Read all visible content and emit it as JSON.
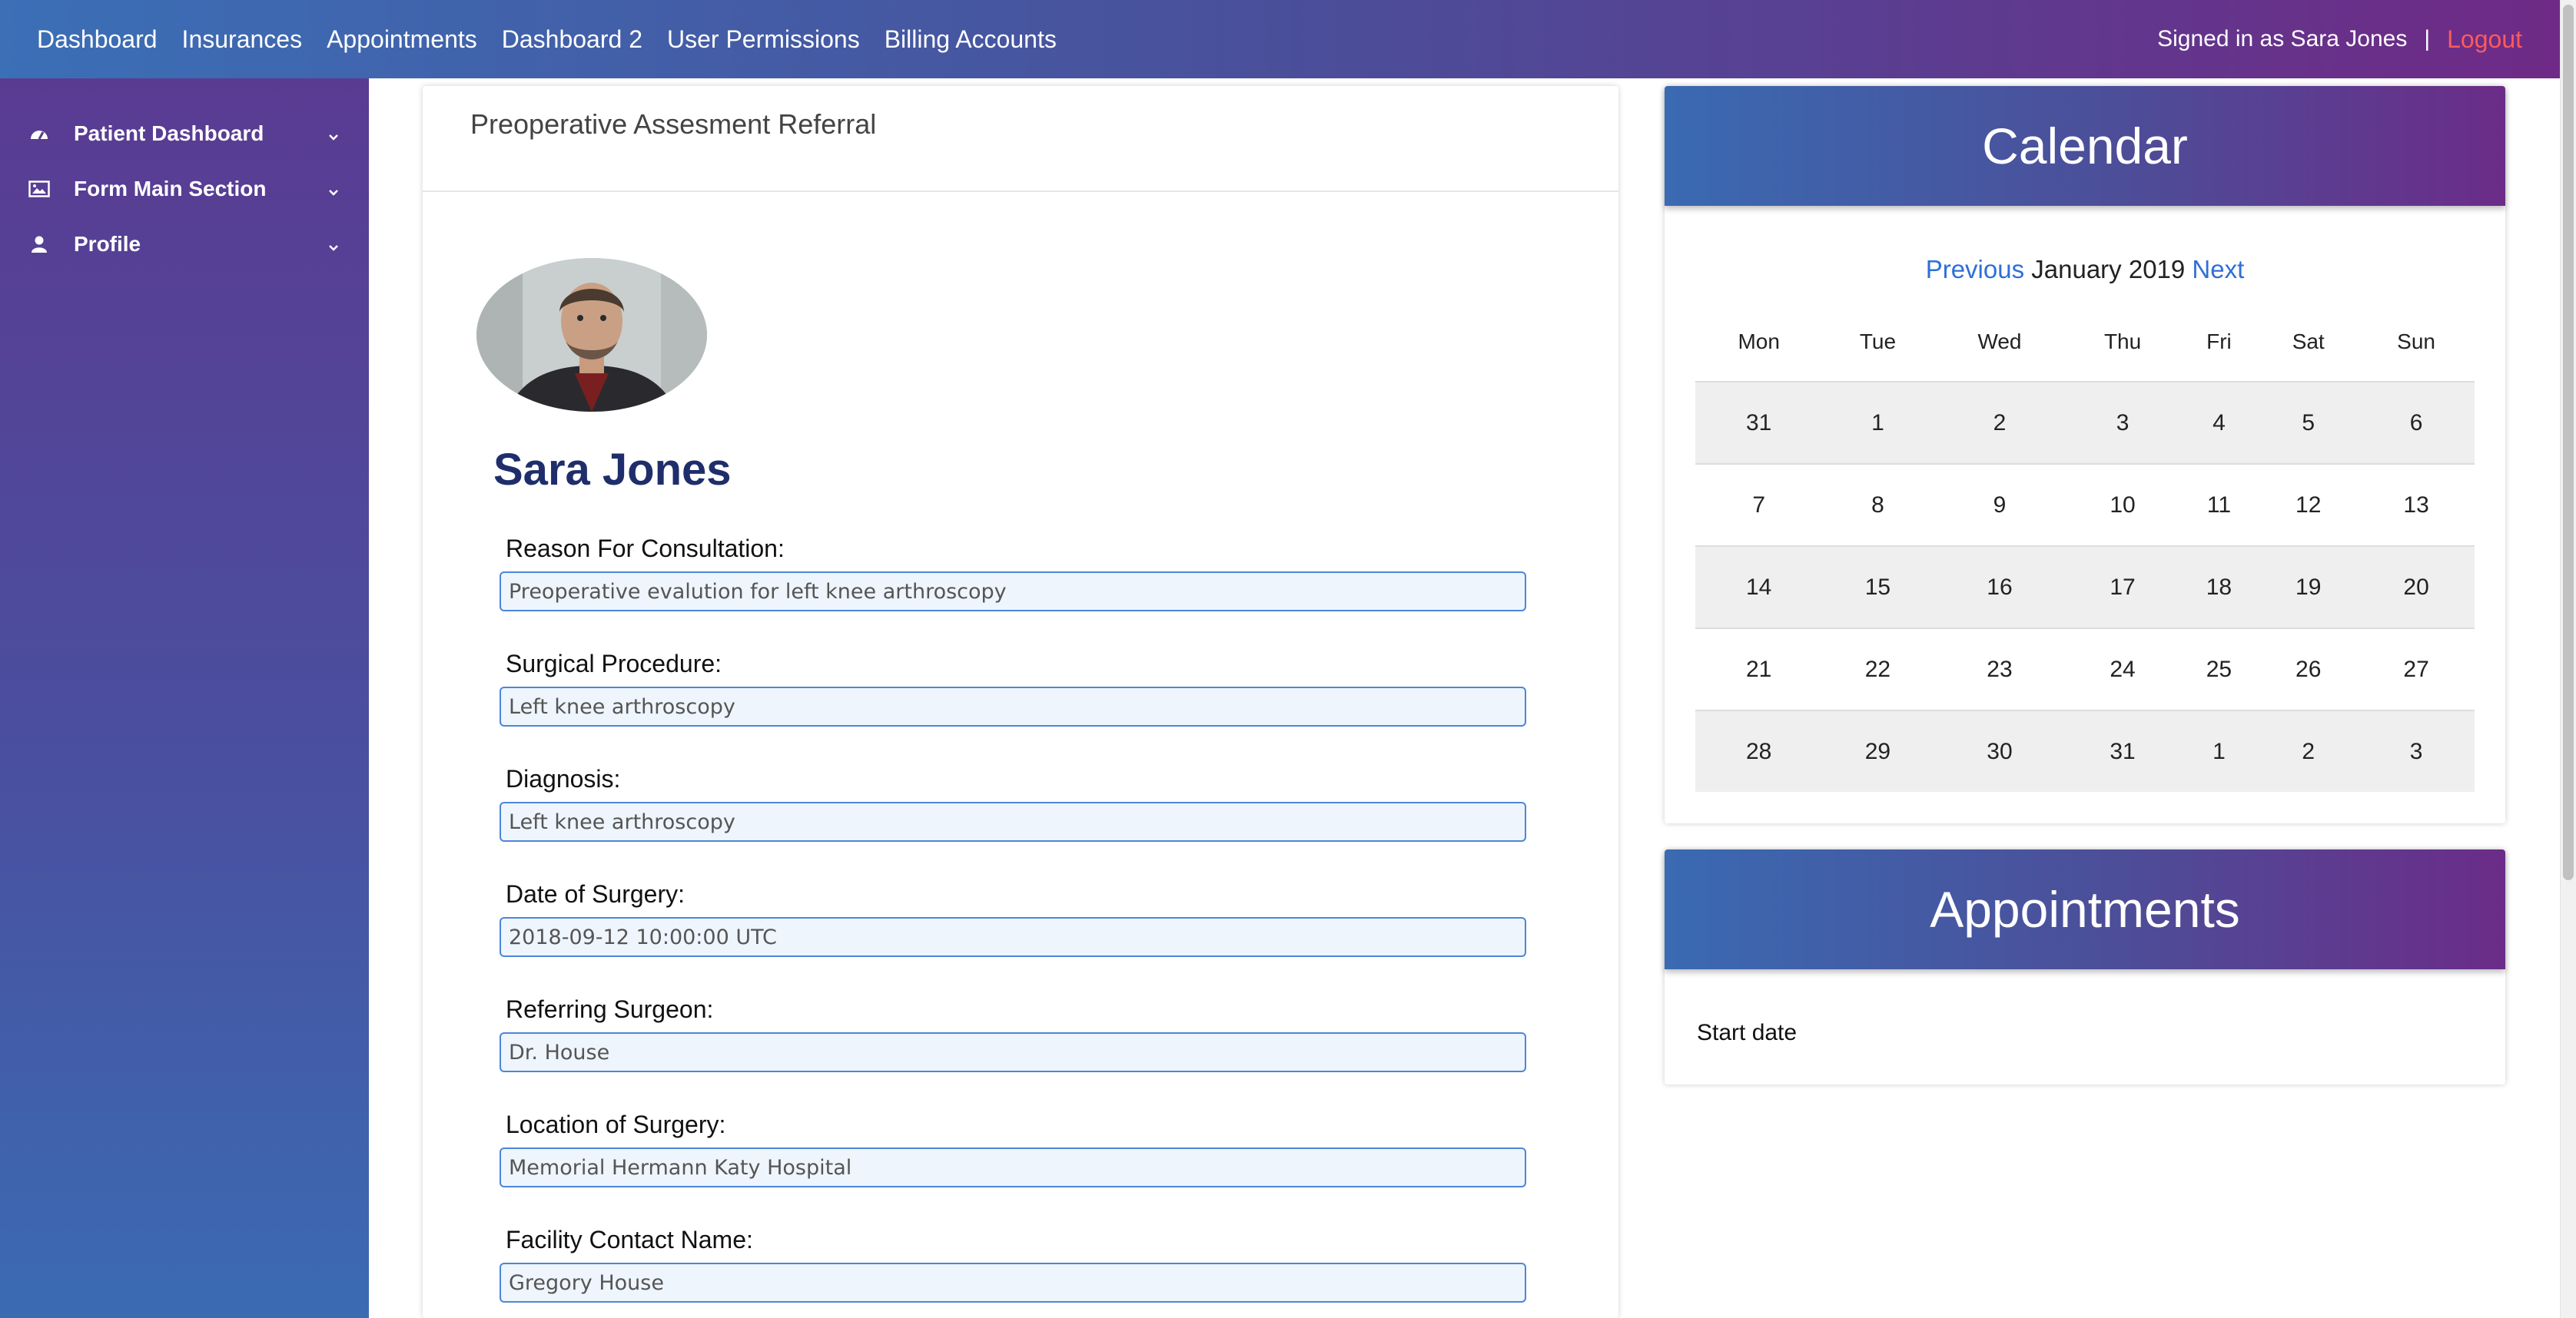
{
  "nav": {
    "links": [
      "Dashboard",
      "Insurances",
      "Appointments",
      "Dashboard 2",
      "User Permissions",
      "Billing Accounts"
    ],
    "signed_in": "Signed in as Sara Jones",
    "separator": "|",
    "logout": "Logout"
  },
  "sidebar": {
    "items": [
      {
        "label": "Patient Dashboard",
        "icon": "dashboard-icon"
      },
      {
        "label": "Form Main Section",
        "icon": "image-icon"
      },
      {
        "label": "Profile",
        "icon": "user-icon"
      }
    ]
  },
  "form": {
    "title": "Preoperative Assesment Referral",
    "patient_name": "Sara Jones",
    "fields": [
      {
        "label": "Reason For Consultation:",
        "value": "Preoperative evalution for left knee arthroscopy"
      },
      {
        "label": "Surgical Procedure:",
        "value": "Left knee arthroscopy"
      },
      {
        "label": "Diagnosis:",
        "value": "Left knee arthroscopy"
      },
      {
        "label": "Date of Surgery:",
        "value": "2018-09-12 10:00:00 UTC"
      },
      {
        "label": "Referring Surgeon:",
        "value": "Dr. House"
      },
      {
        "label": "Location of Surgery:",
        "value": "Memorial Hermann Katy Hospital"
      },
      {
        "label": "Facility Contact Name:",
        "value": "Gregory House"
      }
    ]
  },
  "calendar": {
    "title": "Calendar",
    "prev": "Previous",
    "month": "January 2019",
    "next": "Next",
    "weekdays": [
      "Mon",
      "Tue",
      "Wed",
      "Thu",
      "Fri",
      "Sat",
      "Sun"
    ],
    "weeks": [
      [
        "31",
        "1",
        "2",
        "3",
        "4",
        "5",
        "6"
      ],
      [
        "7",
        "8",
        "9",
        "10",
        "11",
        "12",
        "13"
      ],
      [
        "14",
        "15",
        "16",
        "17",
        "18",
        "19",
        "20"
      ],
      [
        "21",
        "22",
        "23",
        "24",
        "25",
        "26",
        "27"
      ],
      [
        "28",
        "29",
        "30",
        "31",
        "1",
        "2",
        "3"
      ]
    ]
  },
  "appointments": {
    "title": "Appointments",
    "start_date_label": "Start date"
  },
  "colors": {
    "nav_gradient_start": "#3b6fb6",
    "nav_gradient_end": "#6e2a86",
    "logout": "#ff5a5a",
    "link": "#2f6fd6",
    "patient_name": "#1f2e6b",
    "input_border": "#4d86d6"
  }
}
